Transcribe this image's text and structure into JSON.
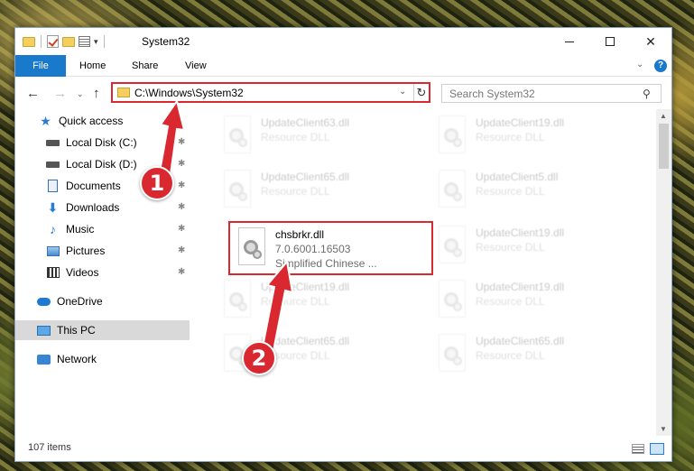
{
  "window": {
    "title": "System32",
    "qat_caret": "▾"
  },
  "ribbon": {
    "tabs": [
      {
        "label": "File"
      },
      {
        "label": "Home"
      },
      {
        "label": "Share"
      },
      {
        "label": "View"
      }
    ],
    "help_label": "?"
  },
  "nav": {
    "address": "C:\\Windows\\System32",
    "search_placeholder": "Search System32"
  },
  "sidebar": {
    "items": [
      {
        "label": "Quick access",
        "icon": "star-icon"
      },
      {
        "label": "Local Disk (C:)",
        "icon": "drive-icon",
        "pinned": true
      },
      {
        "label": "Local Disk (D:)",
        "icon": "drive-icon",
        "pinned": true
      },
      {
        "label": "Documents",
        "icon": "documents-icon",
        "pinned": true
      },
      {
        "label": "Downloads",
        "icon": "download-icon",
        "pinned": true
      },
      {
        "label": "Music",
        "icon": "music-icon",
        "pinned": true
      },
      {
        "label": "Pictures",
        "icon": "pictures-icon",
        "pinned": true
      },
      {
        "label": "Videos",
        "icon": "videos-icon",
        "pinned": true
      },
      {
        "label": "OneDrive",
        "icon": "cloud-icon"
      },
      {
        "label": "This PC",
        "icon": "computer-icon",
        "selected": true
      },
      {
        "label": "Network",
        "icon": "network-icon"
      }
    ]
  },
  "files": [
    {
      "name": "UpdateClient63.dll",
      "type": "Resource DLL",
      "faded": true
    },
    {
      "name": "UpdateClient19.dll",
      "type": "Resource DLL",
      "faded": true
    },
    {
      "name": "UpdateClient65.dll",
      "type": "Resource DLL",
      "faded": true
    },
    {
      "name": "UpdateClient5.dll",
      "type": "Resource DLL",
      "faded": true
    },
    {
      "name": "chsbrkr.dll",
      "version": "7.0.6001.16503",
      "description": "Simplified Chinese ...",
      "highlighted": true
    },
    {
      "name": "UpdateClient19.dll",
      "type": "Resource DLL",
      "faded": true
    },
    {
      "name": "UpdateClient19.dll",
      "type": "Resource DLL",
      "faded": true
    },
    {
      "name": "UpdateClient19.dll",
      "type": "Resource DLL",
      "faded": true
    },
    {
      "name": "UpdateClient65.dll",
      "type": "Resource DLL",
      "faded": true
    },
    {
      "name": "UpdateClient65.dll",
      "type": "Resource DLL",
      "faded": true
    }
  ],
  "status": {
    "item_count": "107 items"
  },
  "annotations": [
    {
      "label": "1"
    },
    {
      "label": "2"
    }
  ],
  "colors": {
    "accent": "#1979ca",
    "highlight": "#d9282f"
  }
}
